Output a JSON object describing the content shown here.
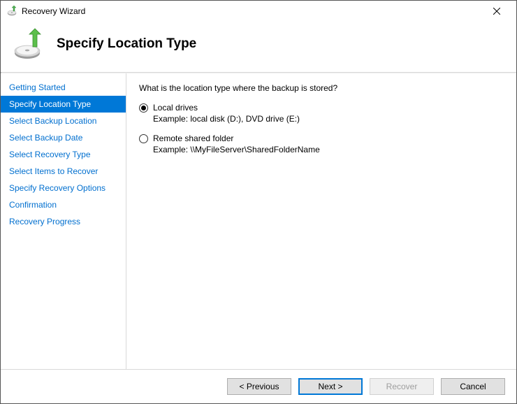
{
  "window": {
    "title": "Recovery Wizard"
  },
  "header": {
    "title": "Specify Location Type"
  },
  "sidebar": {
    "items": [
      {
        "label": "Getting Started",
        "state": "past"
      },
      {
        "label": "Specify Location Type",
        "state": "selected"
      },
      {
        "label": "Select Backup Location",
        "state": "future"
      },
      {
        "label": "Select Backup Date",
        "state": "future"
      },
      {
        "label": "Select Recovery Type",
        "state": "future"
      },
      {
        "label": "Select Items to Recover",
        "state": "future"
      },
      {
        "label": "Specify Recovery Options",
        "state": "future"
      },
      {
        "label": "Confirmation",
        "state": "future"
      },
      {
        "label": "Recovery Progress",
        "state": "future"
      }
    ]
  },
  "content": {
    "question": "What is the location type where the backup is stored?",
    "options": [
      {
        "label": "Local drives",
        "example": "Example: local disk (D:), DVD drive (E:)",
        "checked": true
      },
      {
        "label": "Remote shared folder",
        "example": "Example: \\\\MyFileServer\\SharedFolderName",
        "checked": false
      }
    ]
  },
  "footer": {
    "previous": "< Previous",
    "next": "Next >",
    "recover": "Recover",
    "cancel": "Cancel"
  }
}
